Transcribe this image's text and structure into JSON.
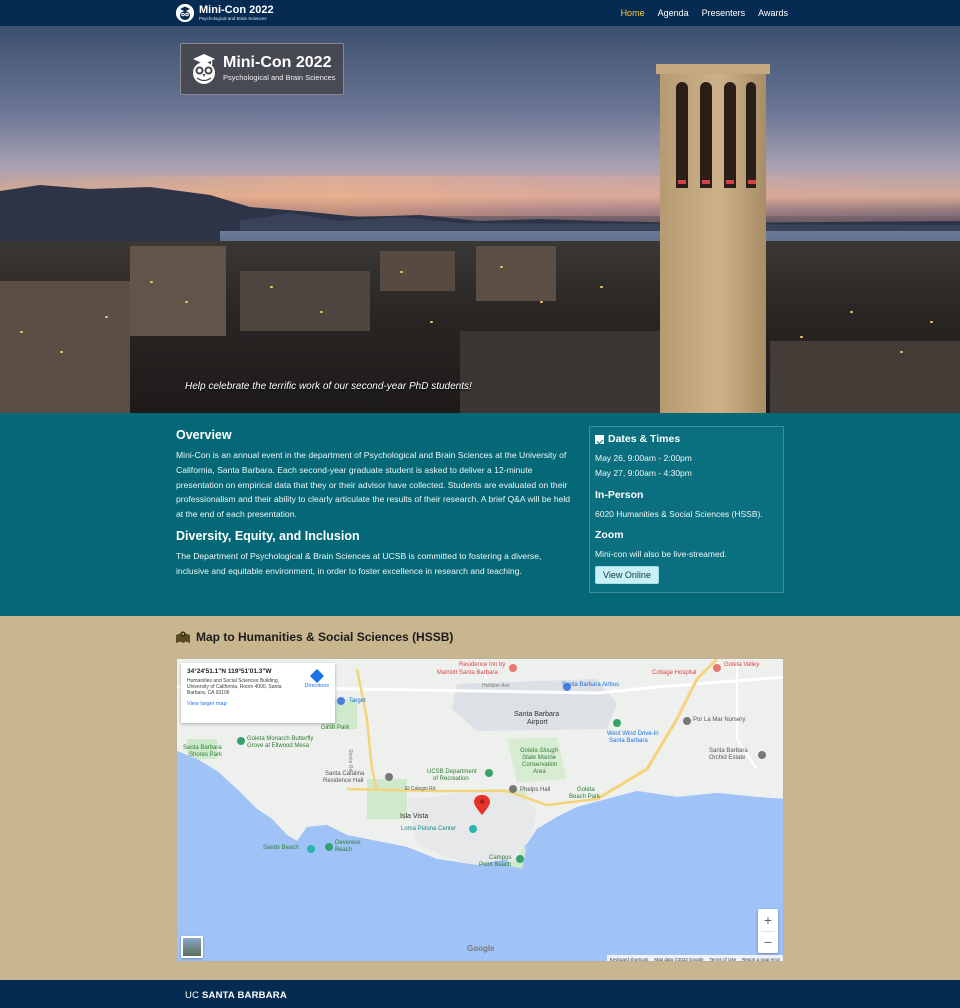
{
  "nav": {
    "brand_title": "Mini-Con 2022",
    "brand_subtitle": "Psychological and Brain Sciences",
    "links": [
      {
        "label": "Home",
        "active": true
      },
      {
        "label": "Agenda",
        "active": false
      },
      {
        "label": "Presenters",
        "active": false
      },
      {
        "label": "Awards",
        "active": false
      }
    ]
  },
  "hero": {
    "logo_title": "Mini-Con 2022",
    "logo_subtitle": "Psychological and Brain Sciences",
    "caption": "Help celebrate the terrific work of our second-year PhD students!"
  },
  "overview": {
    "title": "Overview",
    "body": "Mini-Con is an annual event in the department of Psychological and Brain Sciences at the University of California, Santa Barbara. Each second-year graduate student is asked to deliver a 12-minute presentation on empirical data that they or their advisor have collected. Students are evaluated on their professionalism and their ability to clearly articulate the results of their research. A brief Q&A will be held at the end of each presentation."
  },
  "dei": {
    "title": "Diversity, Equity, and Inclusion",
    "body": "The Department of Psychological & Brain Sciences at UCSB is committed to fostering a diverse, inclusive and equitable environment, in order to foster excellence in research and teaching."
  },
  "sidebar": {
    "dates_title": "Dates & Times",
    "date1": "May 26, 9:00am - 2:00pm",
    "date2": "May 27, 9:00am - 4:30pm",
    "inperson_title": "In-Person",
    "inperson_body": "6020 Humanities & Social Sciences (HSSB).",
    "zoom_title": "Zoom",
    "zoom_body": "Mini-con will also be live-streamed.",
    "view_online": "View Online"
  },
  "map": {
    "title": "Map to Humanities & Social Sciences (HSSB)",
    "card_coord": "34°24'51.1\"N 119°51'01.3\"W",
    "card_addr": "Humanities and Social Sciences Building, University of California, Room 4000, Santa Barbara, CA 93106",
    "card_directions": "Directions",
    "card_larger": "View larger map",
    "labels": {
      "residence_inn": "Residence Inn by",
      "marriott": "Marriott Santa Barbara",
      "goleta_valley": "Goleta Valley",
      "cottage_hospital": "Cottage Hospital",
      "target": "Target",
      "sb_airbus": "Santa Barbara Airbus",
      "sb_airport1": "Santa Barbara",
      "sb_airport2": "Airport",
      "por_la_mar": "Por La Mar Nursery",
      "girsh": "Girsh Park",
      "monarch1": "Goleta Monarch Butterfly",
      "monarch2": "Grove at Ellwood Mesa",
      "westwind1": "West Wind Drive-In",
      "westwind2": "Santa Barbara",
      "shores1": "Santa Barbara",
      "shores2": "Shores Park",
      "slough1": "Goleta Slough",
      "slough2": "State Marine",
      "slough3": "Conservation",
      "slough4": "Area",
      "orchid1": "Santa Barbara",
      "orchid2": "Orchid Estate",
      "catalina1": "Santa Catalina",
      "catalina2": "Residence Hall",
      "ucsb_rec1": "UCSB Department",
      "ucsb_rec2": "of Recreation",
      "phelps": "Phelps Hall",
      "goleta_beach1": "Goleta",
      "goleta_beach2": "Beach Park",
      "el_colegio": "El Colegio Rd",
      "isla_vista": "Isla Vista",
      "loma_pelona": "Loma Pelona Center",
      "sands": "Sands Beach",
      "devereux1": "Devereux",
      "devereux2": "Beach",
      "campus_point1": "Campus",
      "campus_point2": "Point Beach",
      "hollister": "Hollister Ave",
      "storke": "Storke Rd"
    },
    "zoom_in": "+",
    "zoom_out": "−",
    "google": "Google",
    "footer_links": [
      "Keyboard shortcuts",
      "Map data ©2022 Google",
      "Terms of Use",
      "Report a map error"
    ]
  },
  "footer": {
    "uc": "UC",
    "sb": "SANTA BARBARA"
  },
  "colors": {
    "navy": "#062b52",
    "teal": "#046877",
    "sand": "#c8b68e",
    "active_link": "#ffcd3c"
  }
}
